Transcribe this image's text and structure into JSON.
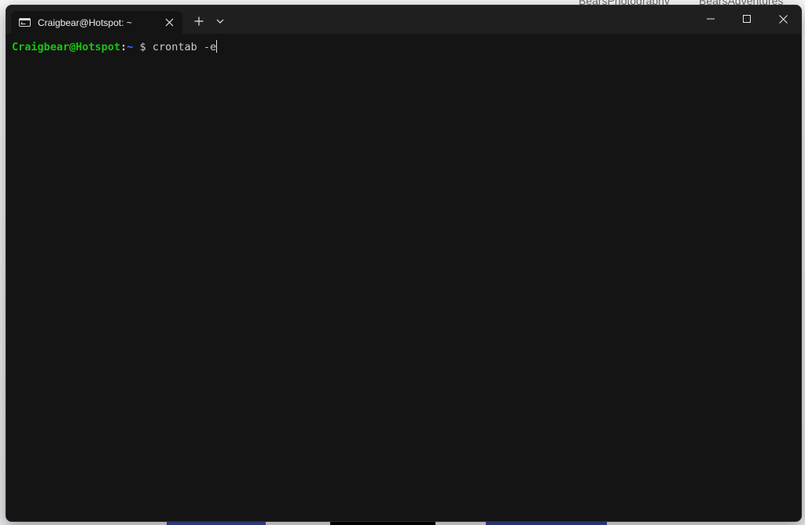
{
  "desktop": {
    "label_left": "BearsPhotography",
    "label_right": "BearsAdventures"
  },
  "window": {
    "tab_title": "Craigbear@Hotspot: ~",
    "tab_icon": "terminal-icon",
    "new_tab_symbol": "+",
    "buttons": {
      "tab_close": "close-icon",
      "new_tab": "plus-icon",
      "dropdown": "chevron-down-icon",
      "minimize": "minimize-icon",
      "maximize": "maximize-icon",
      "close": "close-icon"
    }
  },
  "terminal": {
    "prompt_user": "Craigbear@Hotspot",
    "prompt_sep": ":",
    "prompt_path": "~",
    "prompt_dollar": " $ ",
    "command": "crontab -e"
  },
  "colors": {
    "background": "#141414",
    "titlebar": "#1f1f1f",
    "prompt_user": "#16c60c",
    "prompt_path": "#3b78ff",
    "text": "#cccccc"
  }
}
